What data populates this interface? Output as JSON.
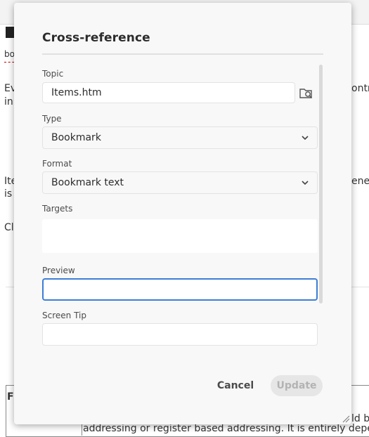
{
  "background": {
    "fragment_bo": "bo",
    "fragment_ev": "Ev",
    "fragment_in": "in",
    "fragment_contro": "ontro",
    "fragment_ite": "Ite",
    "fragment_is": "is",
    "fragment_enea": "enea",
    "fragment_cl": "Cl",
    "fragment_fi": "Fi",
    "fragment_ld_be": "ld be",
    "bottom_text": "addressing or register based addressing. It is entirely depen"
  },
  "dialog": {
    "title": "Cross-reference",
    "topic": {
      "label": "Topic",
      "value": "Items.htm",
      "browse_icon": "folder-search-icon"
    },
    "type": {
      "label": "Type",
      "selected": "Bookmark"
    },
    "format": {
      "label": "Format",
      "selected": "Bookmark text"
    },
    "targets": {
      "label": "Targets"
    },
    "preview": {
      "label": "Preview",
      "value": ""
    },
    "screen_tip": {
      "label": "Screen Tip",
      "value": ""
    },
    "cancel_label": "Cancel",
    "update_label": "Update"
  },
  "colors": {
    "accent": "#3d7ed6",
    "dialog_bg": "#f8f8f8",
    "disabled_button_bg": "#e6e6e6"
  }
}
